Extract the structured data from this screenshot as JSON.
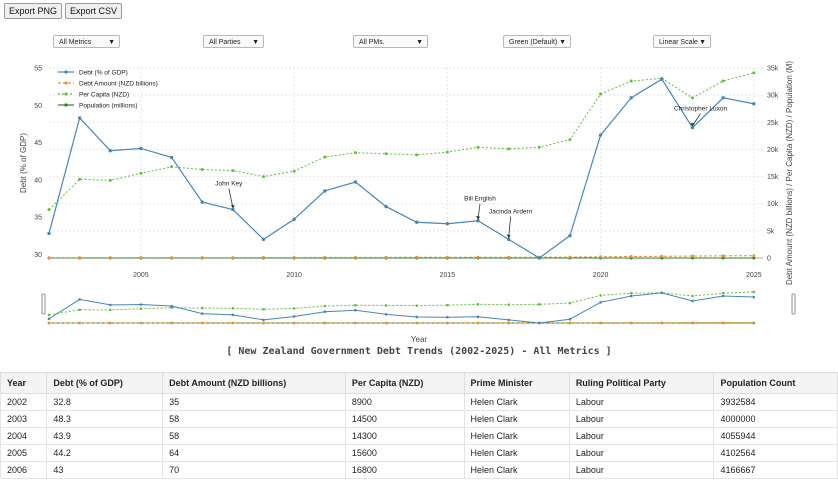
{
  "toolbar": {
    "export_png": "Export PNG",
    "export_csv": "Export CSV"
  },
  "filters": {
    "metrics": "All Metrics",
    "parties": "All Parties",
    "pms": "All PMs.",
    "theme": "Green (Default)",
    "scale": "Linear Scale"
  },
  "colors": {
    "debt_pct": "#4a86b5",
    "debt_amount": "#e8923a",
    "per_capita": "#66bb44",
    "population": "#2e7d32",
    "zero_line": "#c8a96b"
  },
  "chart_data": {
    "type": "line",
    "title": "[ New Zealand Government Debt Trends (2002-2025) - All Metrics ]",
    "xlabel": "Year",
    "ylabel_left": "Debt (% of GDP)",
    "ylabel_right": "Debt Amount (NZD billions) / Per Capita (NZD) / Population (M)",
    "x": [
      2002,
      2003,
      2004,
      2005,
      2006,
      2007,
      2008,
      2009,
      2010,
      2011,
      2012,
      2013,
      2014,
      2015,
      2016,
      2017,
      2018,
      2019,
      2020,
      2021,
      2022,
      2023,
      2024,
      2025
    ],
    "x_ticks": [
      "2005",
      "2010",
      "2015",
      "2020",
      "2025"
    ],
    "y_left_ticks": [
      "30",
      "35",
      "40",
      "45",
      "50",
      "55"
    ],
    "y_right_ticks": [
      "0",
      "5k",
      "10k",
      "15k",
      "20k",
      "25k",
      "30k",
      "35k"
    ],
    "ylim_left": [
      29.5,
      55
    ],
    "ylim_right": [
      0,
      35000
    ],
    "legend_position": "top-left",
    "grid": true,
    "series": [
      {
        "name": "Debt (% of GDP)",
        "axis": "left",
        "values": [
          32.8,
          48.3,
          43.9,
          44.2,
          43,
          37,
          36,
          32,
          34.7,
          38.5,
          39.7,
          36.4,
          34.3,
          34.1,
          34.5,
          32,
          29.5,
          32.5,
          46,
          51,
          53.5,
          47,
          51,
          50.2
        ]
      },
      {
        "name": "Debt Amount (NZD billions)",
        "axis": "right",
        "values": [
          35,
          58,
          58,
          64,
          70,
          75,
          80,
          90,
          100,
          110,
          120,
          125,
          130,
          135,
          140,
          145,
          150,
          160,
          220,
          280,
          320,
          360,
          400,
          420
        ]
      },
      {
        "name": "Per Capita (NZD)",
        "axis": "right",
        "values": [
          8900,
          14500,
          14300,
          15600,
          16800,
          16300,
          16100,
          15000,
          16000,
          18600,
          19400,
          19200,
          19000,
          19500,
          20400,
          20100,
          20400,
          21800,
          30200,
          32600,
          33100,
          29500,
          32600,
          34100
        ]
      },
      {
        "name": "Population (millions)",
        "axis": "right",
        "values": [
          3.93,
          4.0,
          4.06,
          4.1,
          4.17,
          4.23,
          4.27,
          4.32,
          4.37,
          4.4,
          4.43,
          4.47,
          4.56,
          4.65,
          4.75,
          4.84,
          4.9,
          4.98,
          5.09,
          5.11,
          5.12,
          5.2,
          5.27,
          5.3
        ]
      }
    ],
    "annotations": [
      {
        "text": "John Key",
        "x": 2008,
        "series": 0
      },
      {
        "text": "Bill English",
        "x": 2016,
        "series": 0
      },
      {
        "text": "Jacinda Ardern",
        "x": 2017,
        "series": 0
      },
      {
        "text": "Christopher Luxon",
        "x": 2023,
        "series": 0
      }
    ]
  },
  "table": {
    "headers": [
      "Year",
      "Debt (% of GDP)",
      "Debt Amount (NZD billions)",
      "Per Capita (NZD)",
      "Prime Minister",
      "Ruling Political Party",
      "Population Count"
    ],
    "rows": [
      [
        "2002",
        "32.8",
        "35",
        "8900",
        "Helen Clark",
        "Labour",
        "3932584"
      ],
      [
        "2003",
        "48.3",
        "58",
        "14500",
        "Helen Clark",
        "Labour",
        "4000000"
      ],
      [
        "2004",
        "43.9",
        "58",
        "14300",
        "Helen Clark",
        "Labour",
        "4055944"
      ],
      [
        "2005",
        "44.2",
        "64",
        "15600",
        "Helen Clark",
        "Labour",
        "4102564"
      ],
      [
        "2006",
        "43",
        "70",
        "16800",
        "Helen Clark",
        "Labour",
        "4166667"
      ]
    ]
  }
}
